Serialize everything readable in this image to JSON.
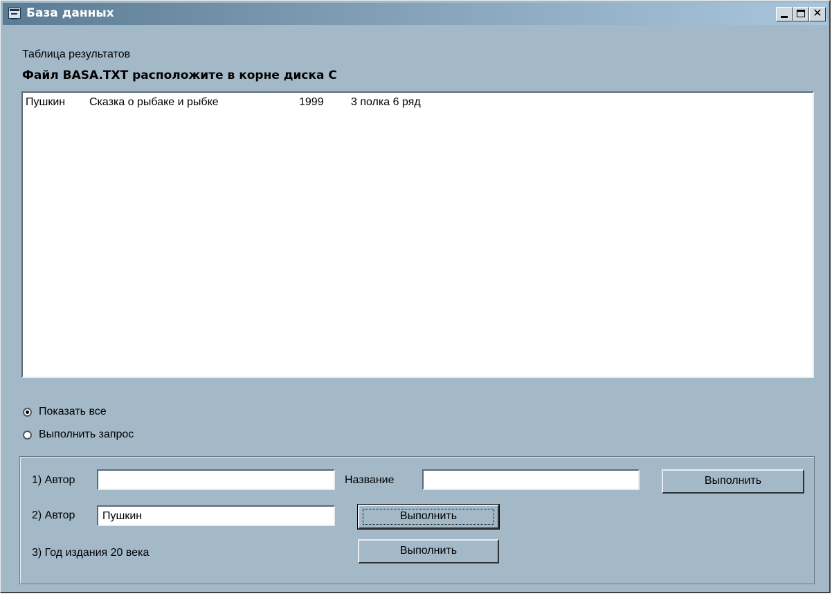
{
  "window": {
    "title": "База данных"
  },
  "header": {
    "results_label": "Таблица результатов",
    "file_note": "Файл BASA.TXT расположите в корне диска С"
  },
  "results": {
    "rows": [
      {
        "author": "Пушкин",
        "title": "Сказка о рыбаке и рыбке",
        "year": "1999",
        "location": "3 полка 6 ряд"
      }
    ]
  },
  "mode": {
    "options": [
      {
        "label": "Показать все",
        "selected": true
      },
      {
        "label": "Выполнить запрос",
        "selected": false
      }
    ]
  },
  "query": {
    "q1": {
      "author_label": "1) Автор",
      "author_value": "",
      "title_label": "Название",
      "title_value": "",
      "run_label": "Выполнить"
    },
    "q2": {
      "author_label": "2) Автор",
      "author_value": "Пушкин",
      "run_label": "Выполнить"
    },
    "q3": {
      "label": "3) Год издания 20 века",
      "run_label": "Выполнить"
    }
  }
}
